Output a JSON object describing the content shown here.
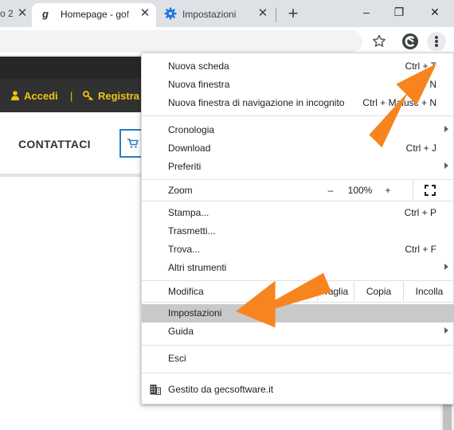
{
  "tabs": {
    "fragment_text": "o 2",
    "active": {
      "title": "Homepage - gof",
      "favicon": "g"
    },
    "second": {
      "title": "Impostazioni"
    },
    "close_glyph": "✕",
    "new_tab_glyph": "+"
  },
  "window_controls": {
    "minimize": "–",
    "restore": "❐",
    "close": "✕"
  },
  "toolbar": {
    "star_icon": "star-icon",
    "extension_icon": "extension-icon",
    "menu_icon": "more-vert-icon"
  },
  "site": {
    "login_label": "Accedi",
    "separator": "|",
    "register_label": "Registra",
    "contact_label": "CONTATTACI",
    "accent_color": "#f2c511",
    "cart_border_color": "#2b7cc1"
  },
  "menu": {
    "items": [
      {
        "label": "Nuova scheda",
        "shortcut": "Ctrl + T"
      },
      {
        "label": "Nuova finestra",
        "shortcut": "Ctrl + N"
      },
      {
        "label": "Nuova finestra di navigazione in incognito",
        "shortcut": "Ctrl + Maiusc + N"
      },
      {
        "label": "Cronologia",
        "shortcut": ""
      },
      {
        "label": "Download",
        "shortcut": "Ctrl + J"
      },
      {
        "label": "Preferiti",
        "shortcut": ""
      },
      {
        "label": "Stampa...",
        "shortcut": "Ctrl + P"
      },
      {
        "label": "Trasmetti...",
        "shortcut": ""
      },
      {
        "label": "Trova...",
        "shortcut": "Ctrl + F"
      },
      {
        "label": "Altri strumenti",
        "shortcut": ""
      },
      {
        "label": "Impostazioni",
        "shortcut": ""
      },
      {
        "label": "Guida",
        "shortcut": ""
      },
      {
        "label": "Esci",
        "shortcut": ""
      }
    ],
    "zoom": {
      "label": "Zoom",
      "minus": "–",
      "value": "100%",
      "plus": "+"
    },
    "edit": {
      "label": "Modifica",
      "cut": "Taglia",
      "copy": "Copia",
      "paste": "Incolla"
    },
    "managed_by": "Gestito da gecsoftware.it",
    "highlight_color": "#c9c9c9"
  },
  "annotation": {
    "arrow_color": "#f7841f"
  }
}
